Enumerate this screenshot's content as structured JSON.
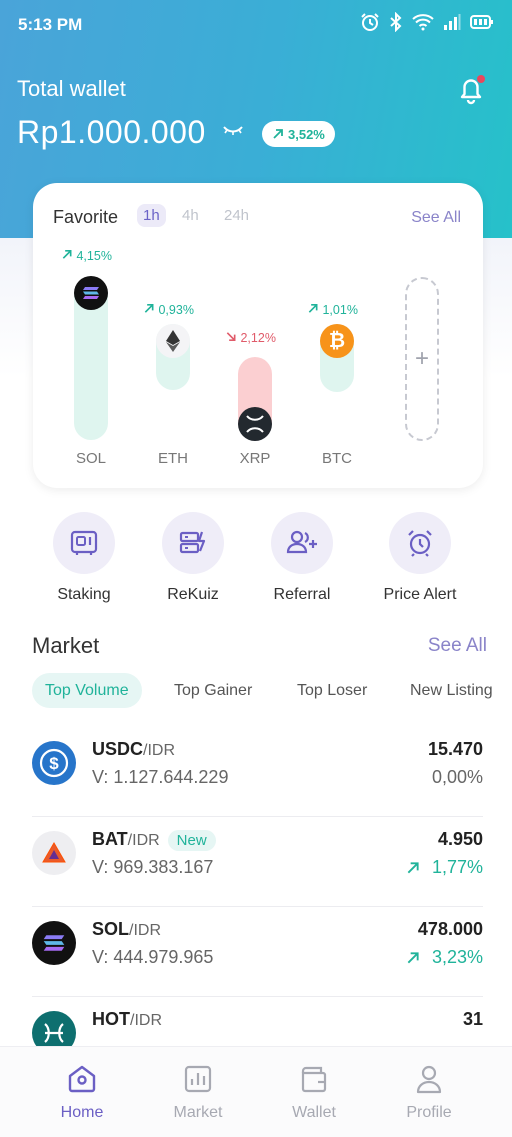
{
  "status": {
    "time": "5:13 PM"
  },
  "wallet": {
    "label": "Total wallet",
    "amount": "Rp1.000.000",
    "change": "3,52%"
  },
  "favorite": {
    "title": "Favorite",
    "tabs": [
      "1h",
      "4h",
      "24h"
    ],
    "active_tab": "1h",
    "see_all": "See All",
    "coins": [
      {
        "name": "SOL",
        "change": "4,15%",
        "direction": "up",
        "level": 1.0
      },
      {
        "name": "ETH",
        "change": "0,93%",
        "direction": "up",
        "level": 0.38
      },
      {
        "name": "XRP",
        "change": "2,12%",
        "direction": "down",
        "level": 0.45
      },
      {
        "name": "BTC",
        "change": "1,01%",
        "direction": "up",
        "level": 0.38
      }
    ]
  },
  "actions": [
    {
      "label": "Staking",
      "icon": "safe-icon"
    },
    {
      "label": "ReKuiz",
      "icon": "quiz-icon"
    },
    {
      "label": "Referral",
      "icon": "add-user-icon"
    },
    {
      "label": "Price Alert",
      "icon": "alarm-clock-icon"
    }
  ],
  "market": {
    "title": "Market",
    "see_all": "See All",
    "tabs": [
      "Top Volume",
      "Top Gainer",
      "Top Loser",
      "New Listing"
    ],
    "active_tab": "Top Volume",
    "rows": [
      {
        "symbol": "USDC",
        "quote": "/IDR",
        "badge": "",
        "volume": "V: 1.127.644.229",
        "price": "15.470",
        "change": "0,00%",
        "direction": "flat"
      },
      {
        "symbol": "BAT",
        "quote": "/IDR",
        "badge": "New",
        "volume": "V: 969.383.167",
        "price": "4.950",
        "change": "1,77%",
        "direction": "up"
      },
      {
        "symbol": "SOL",
        "quote": "/IDR",
        "badge": "",
        "volume": "V: 444.979.965",
        "price": "478.000",
        "change": "3,23%",
        "direction": "up"
      },
      {
        "symbol": "HOT",
        "quote": "/IDR",
        "badge": "",
        "volume": "",
        "price": "31",
        "change": "",
        "direction": "up"
      }
    ]
  },
  "nav": [
    {
      "label": "Home",
      "icon": "home-icon",
      "active": true
    },
    {
      "label": "Market",
      "icon": "chart-icon",
      "active": false
    },
    {
      "label": "Wallet",
      "icon": "wallet-icon",
      "active": false
    },
    {
      "label": "Profile",
      "icon": "profile-icon",
      "active": false
    }
  ],
  "colors": {
    "accent": "#6b5fc4",
    "up": "#20b39a",
    "down": "#e05b6a"
  }
}
